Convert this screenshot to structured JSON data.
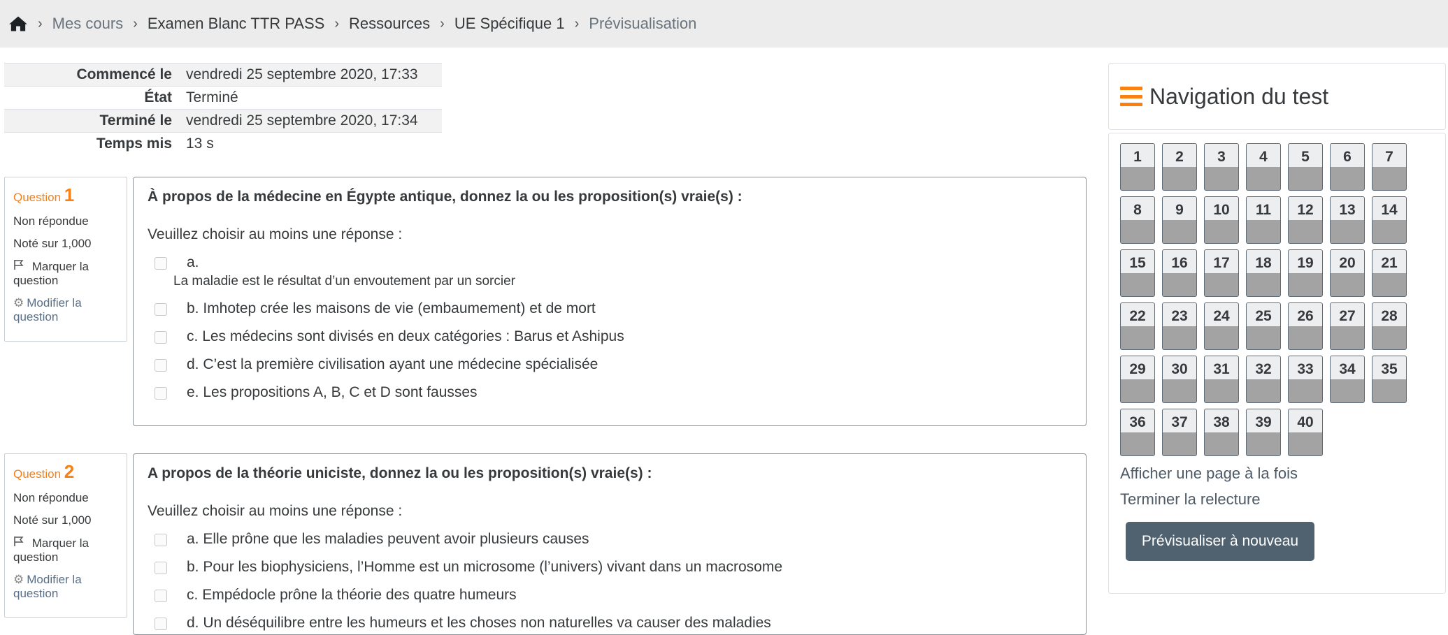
{
  "breadcrumb": {
    "items": [
      "Mes cours",
      "Examen Blanc TTR PASS",
      "Ressources",
      "UE Spécifique 1",
      "Prévisualisation"
    ]
  },
  "summary": [
    {
      "label": "Commencé le",
      "value": "vendredi 25 septembre 2020, 17:33"
    },
    {
      "label": "État",
      "value": "Terminé"
    },
    {
      "label": "Terminé le",
      "value": "vendredi 25 septembre 2020, 17:34"
    },
    {
      "label": "Temps mis",
      "value": "13 s"
    }
  ],
  "questions": [
    {
      "label": "Question",
      "number": "1",
      "status": "Non répondue",
      "grade": "Noté sur 1,000",
      "flag_label": "Marquer la question",
      "edit_label": "Modifier la question",
      "text": "À propos de la médecine en Égypte antique, donnez la ou les proposition(s) vraie(s) :",
      "prompt": "Veuillez choisir au moins une réponse :",
      "answers": [
        {
          "letter": "a.",
          "text": "La maladie est le résultat d’un envoutement par un sorcier"
        },
        {
          "letter": "b.",
          "text": "Imhotep crée les maisons de vie (embaumement) et de mort"
        },
        {
          "letter": "c.",
          "text": "Les médecins sont divisés en deux catégories : Barus et Ashipus"
        },
        {
          "letter": "d.",
          "text": "C’est la première civilisation ayant une médecine spécialisée"
        },
        {
          "letter": "e.",
          "text": "Les propositions A, B, C et D sont fausses"
        }
      ]
    },
    {
      "label": "Question",
      "number": "2",
      "status": "Non répondue",
      "grade": "Noté sur 1,000",
      "flag_label": "Marquer la question",
      "edit_label": "Modifier la question",
      "text": "A propos de la théorie uniciste, donnez la ou les proposition(s) vraie(s) :",
      "prompt": "Veuillez choisir au moins une réponse :",
      "answers": [
        {
          "letter": "a.",
          "text": "Elle prône que les maladies peuvent avoir plusieurs causes"
        },
        {
          "letter": "b.",
          "text": "Pour les biophysiciens, l’Homme est un microsome (l’univers) vivant dans un macrosome"
        },
        {
          "letter": "c.",
          "text": "Empédocle prône la théorie des quatre humeurs"
        },
        {
          "letter": "d.",
          "text": "Un déséquilibre entre les humeurs et les choses non naturelles va causer des maladies"
        }
      ]
    }
  ],
  "nav": {
    "title": "Navigation du test",
    "question_numbers": [
      "1",
      "2",
      "3",
      "4",
      "5",
      "6",
      "7",
      "8",
      "9",
      "10",
      "11",
      "12",
      "13",
      "14",
      "15",
      "16",
      "17",
      "18",
      "19",
      "20",
      "21",
      "22",
      "23",
      "24",
      "25",
      "26",
      "27",
      "28",
      "29",
      "30",
      "31",
      "32",
      "33",
      "34",
      "35",
      "36",
      "37",
      "38",
      "39",
      "40"
    ],
    "show_one_page": "Afficher une page à la fois",
    "finish_review": "Terminer la relecture",
    "preview_again": "Prévisualiser à nouveau"
  },
  "colors": {
    "accent_orange": "#f98012",
    "button_dark": "#50626f",
    "topbar_bg": "#ececec"
  },
  "icons": {
    "home": "home-icon",
    "flag": "flag-icon",
    "gear": "gear-icon",
    "menu": "hamburger-menu-icon"
  }
}
